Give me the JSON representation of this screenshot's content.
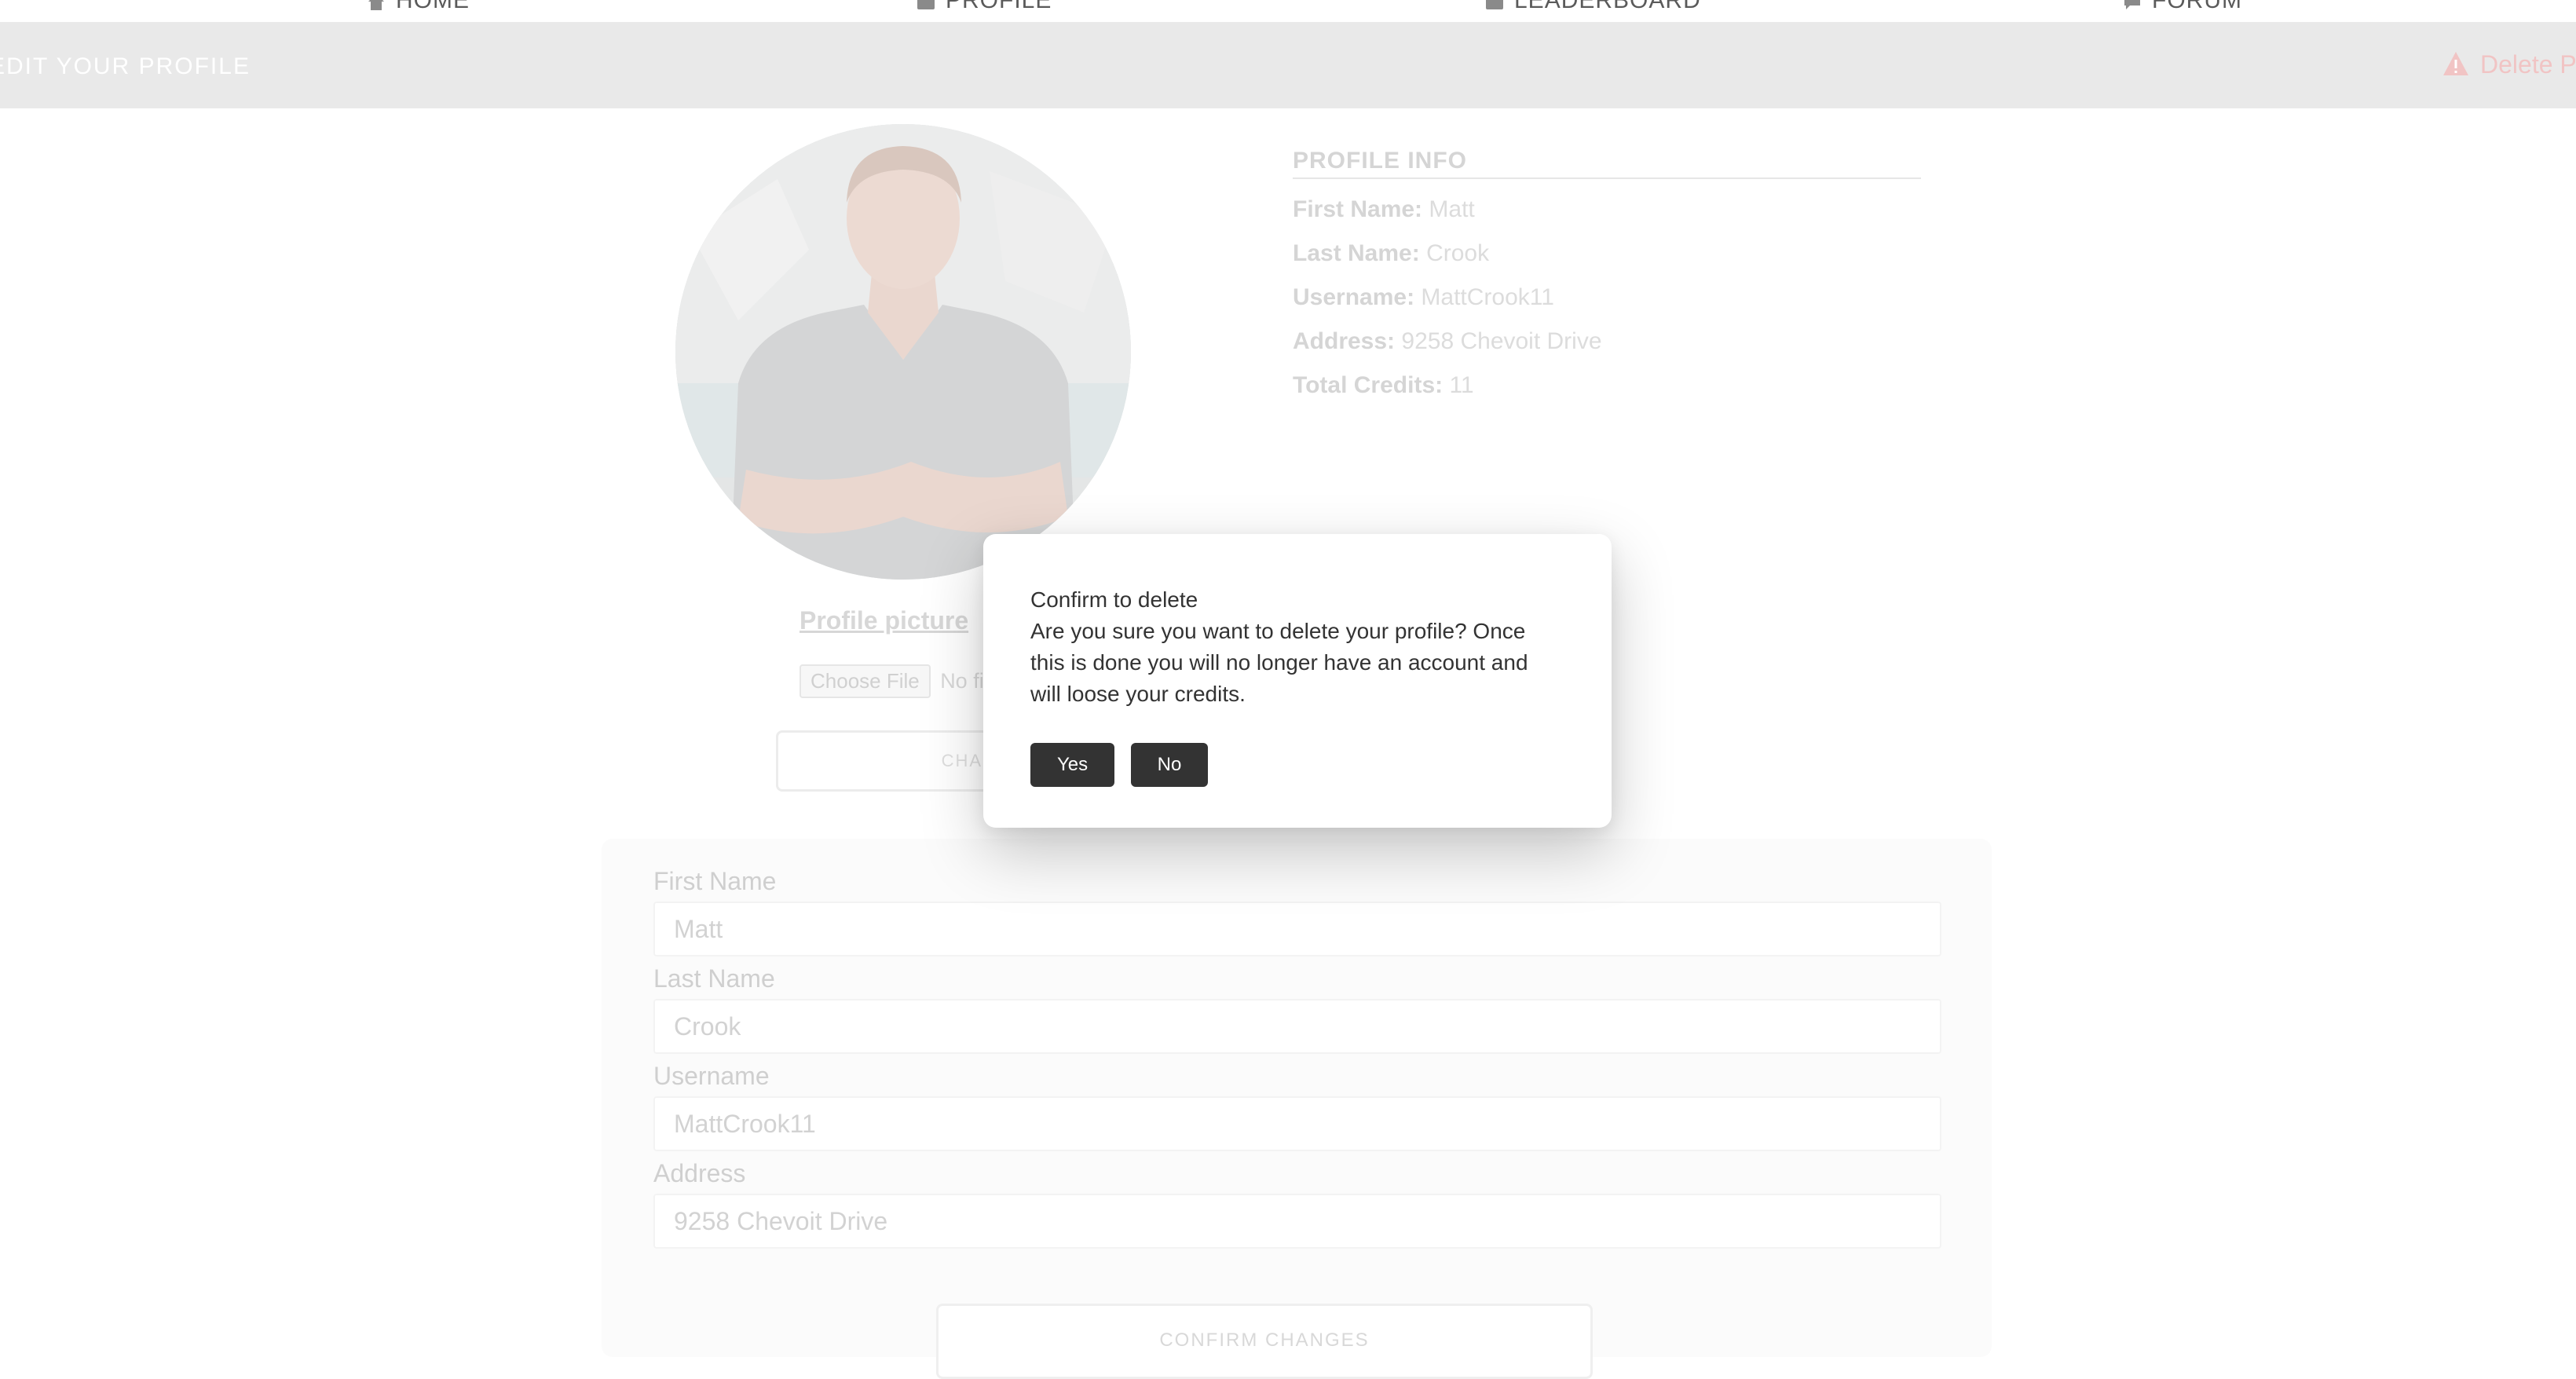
{
  "nav": {
    "items": [
      {
        "label": "HOME",
        "icon": "home-icon"
      },
      {
        "label": "PROFILE",
        "icon": "profile-icon"
      },
      {
        "label": "LEADERBOARD",
        "icon": "leaderboard-icon"
      },
      {
        "label": "FORUM",
        "icon": "forum-icon"
      }
    ]
  },
  "header": {
    "title": "EDIT YOUR PROFILE",
    "delete_label": "Delete Profile",
    "delete_color": "#f1c4c4"
  },
  "profile_picture": {
    "title": "Profile picture",
    "choose_file": "Choose File",
    "no_file": "No file chosen",
    "change_button": "CHANGE PICTURE"
  },
  "profile_info": {
    "title": "PROFILE INFO",
    "rows": [
      {
        "label": "First Name:",
        "value": "Matt"
      },
      {
        "label": "Last Name:",
        "value": "Crook"
      },
      {
        "label": "Username:",
        "value": "MattCrook11"
      },
      {
        "label": "Address:",
        "value": "9258 Chevoit Drive"
      },
      {
        "label": "Total Credits:",
        "value": "11"
      }
    ]
  },
  "form": {
    "fields": [
      {
        "label": "First Name",
        "value": "Matt"
      },
      {
        "label": "Last Name",
        "value": "Crook"
      },
      {
        "label": "Username",
        "value": "MattCrook11"
      },
      {
        "label": "Address",
        "value": "9258 Chevoit Drive"
      }
    ],
    "confirm_button": "CONFIRM CHANGES"
  },
  "modal": {
    "title": "Confirm to delete",
    "message": "Are you sure you want to delete your profile? Once this is done you will no longer have an account and will loose your credits.",
    "yes_label": "Yes",
    "no_label": "No"
  }
}
